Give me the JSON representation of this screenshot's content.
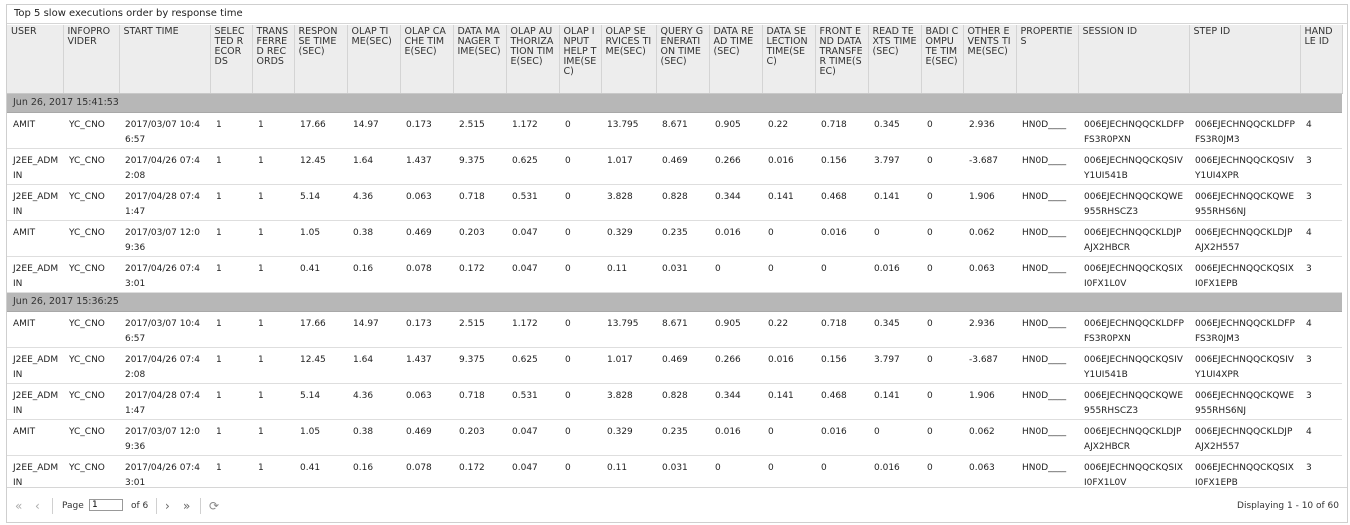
{
  "title": "Top 5 slow executions order by response time",
  "columns": [
    "USER",
    "INFOPROVIDER",
    "START TIME",
    "SELECTED RECORDS",
    "TRANSFERRED RECORDS",
    "RESPONSE TIME(SEC)",
    "OLAP TIME(SEC)",
    "OLAP CACHE TIME(SEC)",
    "DATA MANAGER TIME(SEC)",
    "OLAP AUTHORIZATION TIME(SEC)",
    "OLAP INPUT HELP TIME(SEC)",
    "OLAP SERVICES TIME(SEC)",
    "QUERY GENERATION TIME(SEC)",
    "DATA READ TIME(SEC)",
    "DATA SELECTION TIME(SEC)",
    "FRONT END DATA TRANSFER TIME(SEC)",
    "READ TEXTS TIME(SEC)",
    "BADI COMPUTE TIME(SEC)",
    "OTHER EVENTS TIME(SEC)",
    "PROPERTIES",
    "SESSION ID",
    "STEP ID",
    "HANDLE ID"
  ],
  "groups": [
    {
      "label": "Jun 26, 2017 15:41:53",
      "rows": [
        [
          "AMIT",
          "YC_CNO",
          "2017/03/07 10:46:57",
          "1",
          "1",
          "17.66",
          "14.97",
          "0.173",
          "2.515",
          "1.172",
          "0",
          "13.795",
          "8.671",
          "0.905",
          "0.22",
          "0.718",
          "0.345",
          "0",
          "2.936",
          "HN0D____",
          "006EJECHNQQCKLDFPFS3R0PXN",
          "006EJECHNQQCKLDFPFS3R0JM3",
          "4"
        ],
        [
          "J2EE_ADMIN",
          "YC_CNO",
          "2017/04/26 07:42:08",
          "1",
          "1",
          "12.45",
          "1.64",
          "1.437",
          "9.375",
          "0.625",
          "0",
          "1.017",
          "0.469",
          "0.266",
          "0.016",
          "0.156",
          "3.797",
          "0",
          "-3.687",
          "HN0D____",
          "006EJECHNQQCKQSIVY1UI541B",
          "006EJECHNQQCKQSIVY1UI4XPR",
          "3"
        ],
        [
          "J2EE_ADMIN",
          "YC_CNO",
          "2017/04/28 07:41:47",
          "1",
          "1",
          "5.14",
          "4.36",
          "0.063",
          "0.718",
          "0.531",
          "0",
          "3.828",
          "0.828",
          "0.344",
          "0.141",
          "0.468",
          "0.141",
          "0",
          "1.906",
          "HN0D____",
          "006EJECHNQQCKQWE955RHSCZ3",
          "006EJECHNQQCKQWE955RHS6NJ",
          "3"
        ],
        [
          "AMIT",
          "YC_CNO",
          "2017/03/07 12:09:36",
          "1",
          "1",
          "1.05",
          "0.38",
          "0.469",
          "0.203",
          "0.047",
          "0",
          "0.329",
          "0.235",
          "0.016",
          "0",
          "0.016",
          "0",
          "0",
          "0.062",
          "HN0D____",
          "006EJECHNQQCKLDJPAJX2HBCR",
          "006EJECHNQQCKLDJPAJX2H557",
          "4"
        ],
        [
          "J2EE_ADMIN",
          "YC_CNO",
          "2017/04/26 07:43:01",
          "1",
          "1",
          "0.41",
          "0.16",
          "0.078",
          "0.172",
          "0.047",
          "0",
          "0.11",
          "0.031",
          "0",
          "0",
          "0",
          "0.016",
          "0",
          "0.063",
          "HN0D____",
          "006EJECHNQQCKQSIXI0FX1L0V",
          "006EJECHNQQCKQSIXI0FX1EPB",
          "3"
        ]
      ]
    },
    {
      "label": "Jun 26, 2017 15:36:25",
      "rows": [
        [
          "AMIT",
          "YC_CNO",
          "2017/03/07 10:46:57",
          "1",
          "1",
          "17.66",
          "14.97",
          "0.173",
          "2.515",
          "1.172",
          "0",
          "13.795",
          "8.671",
          "0.905",
          "0.22",
          "0.718",
          "0.345",
          "0",
          "2.936",
          "HN0D____",
          "006EJECHNQQCKLDFPFS3R0PXN",
          "006EJECHNQQCKLDFPFS3R0JM3",
          "4"
        ],
        [
          "J2EE_ADMIN",
          "YC_CNO",
          "2017/04/26 07:42:08",
          "1",
          "1",
          "12.45",
          "1.64",
          "1.437",
          "9.375",
          "0.625",
          "0",
          "1.017",
          "0.469",
          "0.266",
          "0.016",
          "0.156",
          "3.797",
          "0",
          "-3.687",
          "HN0D____",
          "006EJECHNQQCKQSIVY1UI541B",
          "006EJECHNQQCKQSIVY1UI4XPR",
          "3"
        ],
        [
          "J2EE_ADMIN",
          "YC_CNO",
          "2017/04/28 07:41:47",
          "1",
          "1",
          "5.14",
          "4.36",
          "0.063",
          "0.718",
          "0.531",
          "0",
          "3.828",
          "0.828",
          "0.344",
          "0.141",
          "0.468",
          "0.141",
          "0",
          "1.906",
          "HN0D____",
          "006EJECHNQQCKQWE955RHSCZ3",
          "006EJECHNQQCKQWE955RHS6NJ",
          "3"
        ],
        [
          "AMIT",
          "YC_CNO",
          "2017/03/07 12:09:36",
          "1",
          "1",
          "1.05",
          "0.38",
          "0.469",
          "0.203",
          "0.047",
          "0",
          "0.329",
          "0.235",
          "0.016",
          "0",
          "0.016",
          "0",
          "0",
          "0.062",
          "HN0D____",
          "006EJECHNQQCKLDJPAJX2HBCR",
          "006EJECHNQQCKLDJPAJX2H557",
          "4"
        ],
        [
          "J2EE_ADMIN",
          "YC_CNO",
          "2017/04/26 07:43:01",
          "1",
          "1",
          "0.41",
          "0.16",
          "0.078",
          "0.172",
          "0.047",
          "0",
          "0.11",
          "0.031",
          "0",
          "0",
          "0",
          "0.016",
          "0",
          "0.063",
          "HN0D____",
          "006EJECHNQQCKQSIXI0FX1L0V",
          "006EJECHNQQCKQSIXI0FX1EPB",
          "3"
        ]
      ]
    }
  ],
  "pager": {
    "first_icon": "«",
    "prev_icon": "‹",
    "page_label": "Page",
    "page_value": "1",
    "of_label": "of 6",
    "next_icon": "›",
    "last_icon": "»",
    "refresh_icon": "⟳",
    "display": "Displaying 1 - 10 of 60"
  }
}
